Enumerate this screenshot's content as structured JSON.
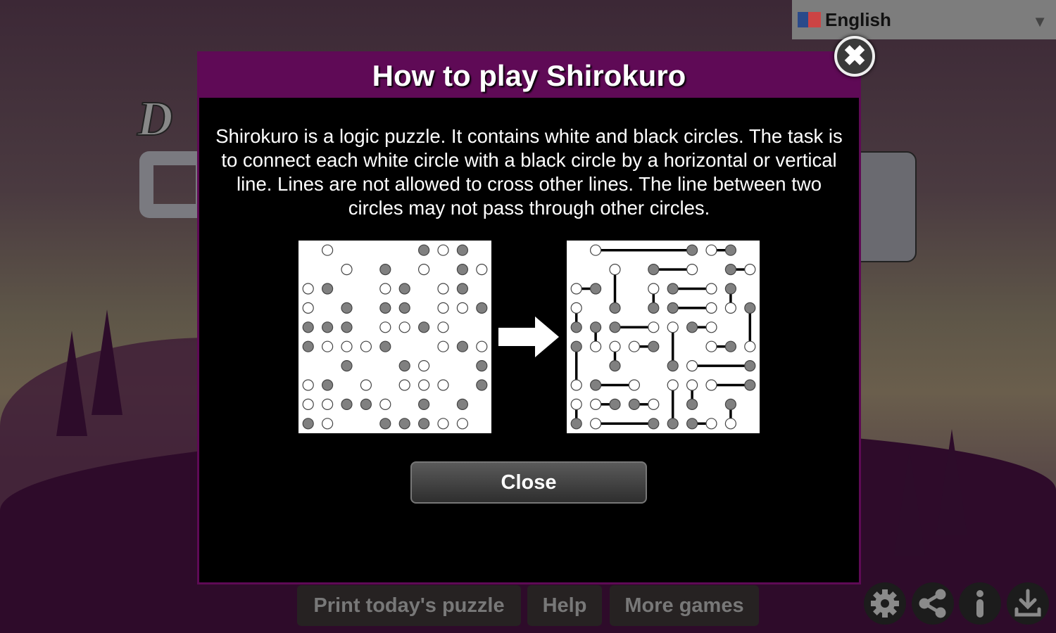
{
  "language": {
    "label": "English",
    "flag": "uk-flag-icon"
  },
  "modal": {
    "title": "How to play Shirokuro",
    "text": "Shirokuro is a logic puzzle. It contains white and black circles. The task is to connect each white circle with a black circle by a horizontal or vertical line. Lines are not allowed to cross other lines. The line between two circles may not pass through other circles.",
    "close_label": "Close"
  },
  "example": {
    "grid": [
      ".W....BWB.",
      "..W.B.W.BW",
      "WB..WB.WB.",
      "W.B.BB.WWB",
      "BBB.WWBW..",
      "BWWWB..WBW",
      "..B..BW..B",
      "WB.W.WWW.B",
      "WWBBW.B.B.",
      "BW..BBBWW."
    ],
    "solution_lines": [
      [
        0,
        1,
        0,
        6
      ],
      [
        0,
        7,
        0,
        8
      ],
      [
        1,
        4,
        1,
        6
      ],
      [
        1,
        8,
        1,
        9
      ],
      [
        1,
        2,
        3,
        2
      ],
      [
        2,
        0,
        2,
        1
      ],
      [
        2,
        4,
        3,
        4
      ],
      [
        2,
        5,
        2,
        7
      ],
      [
        2,
        8,
        3,
        8
      ],
      [
        3,
        0,
        4,
        0
      ],
      [
        3,
        5,
        3,
        7
      ],
      [
        3,
        9,
        5,
        9
      ],
      [
        4,
        1,
        5,
        1
      ],
      [
        4,
        2,
        4,
        4
      ],
      [
        4,
        5,
        6,
        5
      ],
      [
        4,
        6,
        4,
        7
      ],
      [
        5,
        0,
        7,
        0
      ],
      [
        5,
        2,
        6,
        2
      ],
      [
        5,
        3,
        5,
        4
      ],
      [
        5,
        7,
        5,
        8
      ],
      [
        6,
        6,
        6,
        9
      ],
      [
        7,
        1,
        7,
        3
      ],
      [
        7,
        5,
        9,
        5
      ],
      [
        7,
        6,
        8,
        6
      ],
      [
        7,
        7,
        7,
        9
      ],
      [
        8,
        0,
        9,
        0
      ],
      [
        8,
        1,
        8,
        2
      ],
      [
        8,
        3,
        8,
        4
      ],
      [
        8,
        8,
        9,
        8
      ],
      [
        9,
        1,
        9,
        4
      ],
      [
        9,
        6,
        9,
        7
      ]
    ],
    "colors": {
      "white": "#ffffff",
      "black": "#808080",
      "line": "#000000"
    }
  },
  "bottom": {
    "print": "Print today's puzzle",
    "help": "Help",
    "more": "More games"
  },
  "icons": [
    "gear-icon",
    "share-icon",
    "info-icon",
    "download-icon"
  ],
  "colors": {
    "accent": "#5f0a56",
    "modal_bg": "#000000"
  }
}
